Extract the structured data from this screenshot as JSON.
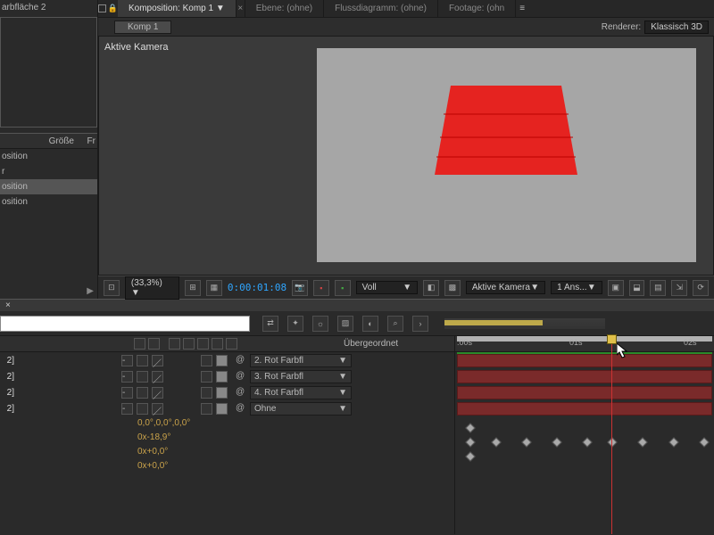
{
  "project": {
    "visible_item": "arbfläche 2",
    "columns": {
      "size": "Größe",
      "fr": "Fr"
    },
    "items": [
      "osition",
      "r",
      "osition"
    ],
    "selected_item": "osition"
  },
  "viewer": {
    "tabs": [
      {
        "label": "Komposition: Komp 1 ▼",
        "active": true
      },
      {
        "label": "Ebene: (ohne)",
        "active": false
      },
      {
        "label": "Flussdiagramm: (ohne)",
        "active": false
      },
      {
        "label": "Footage: (ohn",
        "active": false
      }
    ],
    "crumb": "Komp 1",
    "renderer_label": "Renderer:",
    "renderer_value": "Klassisch 3D",
    "camera_label": "Aktive Kamera"
  },
  "toolbar": {
    "zoom": "(33,3%)  ▼",
    "timecode": "0:00:01:08",
    "resolution": "Voll",
    "camera": "Aktive Kamera",
    "views": "1 Ans..."
  },
  "timeline": {
    "close": "×",
    "parent_header": "Übergeordnet",
    "time_labels": [
      ":00s",
      "01s",
      "02s"
    ],
    "cti_pct": 60,
    "layers": [
      {
        "num": "2]",
        "parent": "2. Rot Farbfl"
      },
      {
        "num": "2]",
        "parent": "3. Rot Farbfl"
      },
      {
        "num": "2]",
        "parent": "4. Rot Farbfl"
      },
      {
        "num": "2]",
        "parent": "Ohne"
      }
    ],
    "props": [
      {
        "value": "0,0°,0,0°,0,0°"
      },
      {
        "value": "0x-18,9°"
      },
      {
        "value": "0x+0,0°"
      },
      {
        "value": "0x+0,0°"
      }
    ],
    "keyframe_cols_pct": [
      4,
      14,
      26,
      38,
      50,
      60,
      72,
      84,
      96
    ]
  }
}
